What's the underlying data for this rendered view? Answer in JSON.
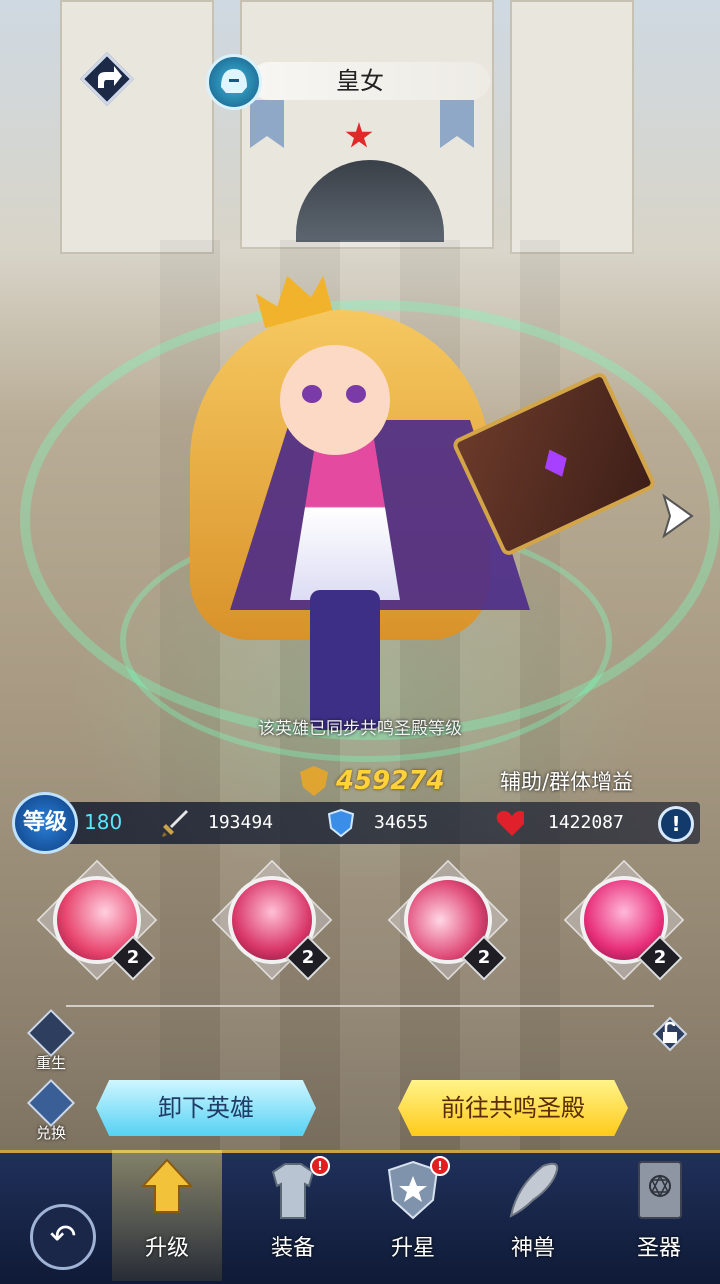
{
  "header": {
    "hero_name": "皇女"
  },
  "status": {
    "sync_notice": "该英雄已同步共鸣圣殿等级"
  },
  "hero": {
    "power": "459274",
    "role": "辅助/群体增益",
    "level_badge": "等级",
    "level": "180",
    "attack": "193494",
    "defense": "34655",
    "hp": "1422087"
  },
  "skills": [
    {
      "level": "2",
      "color": "#e8456e"
    },
    {
      "level": "2",
      "color": "#d9386a"
    },
    {
      "level": "2",
      "color": "#e04a78"
    },
    {
      "level": "2",
      "color": "#e8307a"
    }
  ],
  "side": {
    "rebirth_label": "重生",
    "exchange_label": "兑换"
  },
  "actions": {
    "unequip_label": "卸下英雄",
    "resonance_label": "前往共鸣圣殿"
  },
  "tabs": [
    {
      "label": "升级",
      "active": true,
      "badge": ""
    },
    {
      "label": "装备",
      "active": false,
      "badge": "!"
    },
    {
      "label": "升星",
      "active": false,
      "badge": "!"
    },
    {
      "label": "神兽",
      "active": false,
      "badge": ""
    },
    {
      "label": "圣器",
      "active": false,
      "badge": ""
    }
  ],
  "info_icon": "!",
  "colors": {
    "power": "#ffd23a",
    "level": "#58e6ff",
    "primary_button": "#55d2f4",
    "secondary_button": "#ffca1a"
  }
}
